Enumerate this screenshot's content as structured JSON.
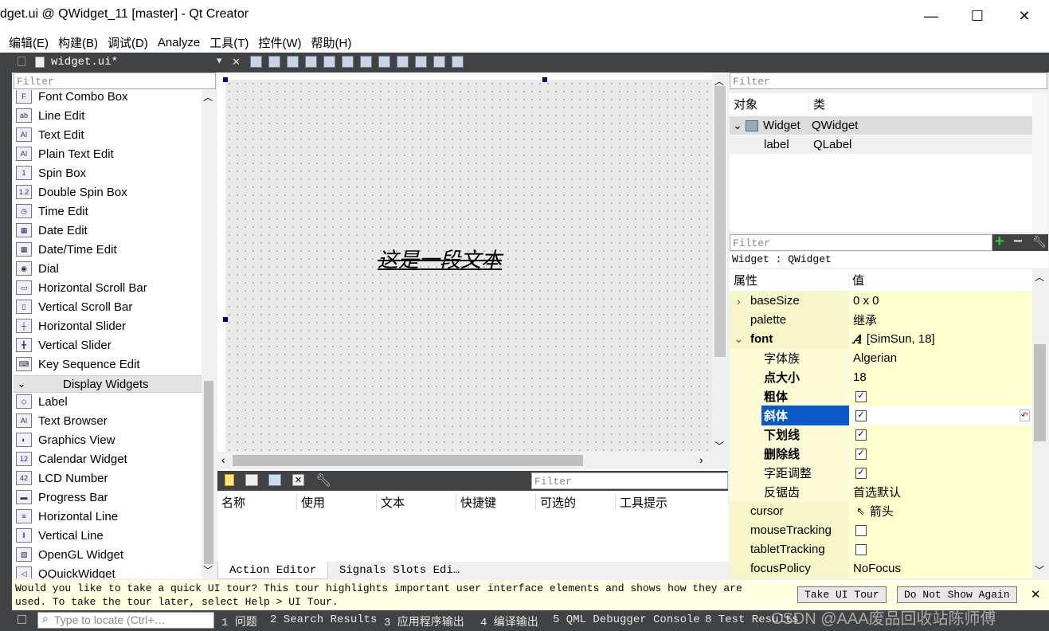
{
  "window": {
    "title": "dget.ui @ QWidget_11 [master] - Qt Creator",
    "minimize_glyph": "—",
    "maximize_glyph": "☐",
    "close_glyph": "✕"
  },
  "menu": [
    "编辑(E)",
    "构建(B)",
    "调试(D)",
    "Analyze",
    "工具(T)",
    "控件(W)",
    "帮助(H)"
  ],
  "editor_tab": {
    "file": "widget.ui*",
    "dropdown_glyph": "▾",
    "close_glyph": "✕"
  },
  "widget_box": {
    "filter_placeholder": "Filter",
    "items_top": [
      {
        "label": "Font Combo Box",
        "icon": "font-combo-icon",
        "glyph": "F"
      },
      {
        "label": "Line Edit",
        "icon": "line-edit-icon",
        "glyph": "ab"
      },
      {
        "label": "Text Edit",
        "icon": "text-edit-icon",
        "glyph": "AI"
      },
      {
        "label": "Plain Text Edit",
        "icon": "plain-text-edit-icon",
        "glyph": "AI"
      },
      {
        "label": "Spin Box",
        "icon": "spin-box-icon",
        "glyph": "1"
      },
      {
        "label": "Double Spin Box",
        "icon": "double-spin-box-icon",
        "glyph": "1.2"
      },
      {
        "label": "Time Edit",
        "icon": "clock-icon",
        "glyph": "◷"
      },
      {
        "label": "Date Edit",
        "icon": "calendar-icon",
        "glyph": "▦"
      },
      {
        "label": "Date/Time Edit",
        "icon": "calendar-clock-icon",
        "glyph": "▦"
      },
      {
        "label": "Dial",
        "icon": "dial-icon",
        "glyph": "◉"
      },
      {
        "label": "Horizontal Scroll Bar",
        "icon": "hscroll-icon",
        "glyph": "▭"
      },
      {
        "label": "Vertical Scroll Bar",
        "icon": "vscroll-icon",
        "glyph": "▯"
      },
      {
        "label": "Horizontal Slider",
        "icon": "hslider-icon",
        "glyph": "┼"
      },
      {
        "label": "Vertical Slider",
        "icon": "vslider-icon",
        "glyph": "╋"
      },
      {
        "label": "Key Sequence Edit",
        "icon": "key-sequence-icon",
        "glyph": "⌨"
      }
    ],
    "category": "Display Widgets",
    "category_glyph": "⌄",
    "items_display": [
      {
        "label": "Label",
        "icon": "label-tag-icon",
        "glyph": "◇"
      },
      {
        "label": "Text Browser",
        "icon": "text-browser-icon",
        "glyph": "AI"
      },
      {
        "label": "Graphics View",
        "icon": "graphics-view-icon",
        "glyph": "◐"
      },
      {
        "label": "Calendar Widget",
        "icon": "calendar-widget-icon",
        "glyph": "12"
      },
      {
        "label": "LCD Number",
        "icon": "lcd-icon",
        "glyph": "42"
      },
      {
        "label": "Progress Bar",
        "icon": "progress-icon",
        "glyph": "▬"
      },
      {
        "label": "Horizontal Line",
        "icon": "hline-icon",
        "glyph": "≡"
      },
      {
        "label": "Vertical Line",
        "icon": "vline-icon",
        "glyph": "‖"
      },
      {
        "label": "OpenGL Widget",
        "icon": "opengl-icon",
        "glyph": "▨"
      },
      {
        "label": "QQuickWidget",
        "icon": "quick-widget-icon",
        "glyph": "◁"
      }
    ]
  },
  "canvas": {
    "label_text": "这是一段文本"
  },
  "action_editor": {
    "filter_placeholder": "Filter",
    "columns": [
      "名称",
      "使用",
      "文本",
      "快捷键",
      "可选的",
      "工具提示"
    ],
    "tabs": [
      "Action Editor",
      "Signals  Slots Edi…"
    ]
  },
  "object_inspector": {
    "filter_placeholder": "Filter",
    "columns": [
      "对象",
      "类"
    ],
    "rows": [
      {
        "object": "Widget",
        "class": "QWidget"
      },
      {
        "object": "label",
        "class": "QLabel"
      }
    ]
  },
  "property_editor": {
    "filter_placeholder": "Filter",
    "context": "Widget : QWidget",
    "columns": [
      "属性",
      "值"
    ],
    "rows": [
      {
        "name": "baseSize",
        "value": "0 x 0",
        "expander": "›"
      },
      {
        "name": "palette",
        "value": "继承"
      },
      {
        "name": "font",
        "value": "[SimSun, 18]",
        "expander": "⌄",
        "bold": true
      },
      {
        "name": "字体族",
        "value": "Algerian",
        "sub": true
      },
      {
        "name": "点大小",
        "value": "18",
        "sub": true,
        "bold": true
      },
      {
        "name": "粗体",
        "checked": true,
        "sub": true,
        "bold": true
      },
      {
        "name": "斜体",
        "checked": true,
        "sub": true,
        "bold": true,
        "selected": true
      },
      {
        "name": "下划线",
        "checked": true,
        "sub": true,
        "bold": true
      },
      {
        "name": "删除线",
        "checked": true,
        "sub": true,
        "bold": true
      },
      {
        "name": "字距调整",
        "checked": true,
        "sub": true
      },
      {
        "name": "反锯齿",
        "value": "首选默认",
        "sub": true
      },
      {
        "name": "cursor",
        "value": "箭头"
      },
      {
        "name": "mouseTracking",
        "checked": false
      },
      {
        "name": "tabletTracking",
        "checked": false
      },
      {
        "name": "focusPolicy",
        "value": "NoFocus"
      }
    ]
  },
  "notification": {
    "message_line1": "Would you like to take a quick UI tour? This tour highlights important user interface elements and shows how they are",
    "message_line2": "used. To take the tour later, select Help > UI Tour.",
    "take_tour": "Take UI Tour",
    "dont_show": "Do Not Show Again",
    "close_glyph": "✕"
  },
  "status_bar": {
    "locate_placeholder": "Type to locate (Ctrl+…",
    "items": [
      "1 问题",
      "2 Search Results",
      "3 应用程序输出",
      "4 编译输出",
      "5 QML Debugger Console",
      "8 Test Results"
    ],
    "watermark": "CSDN @AAA废品回收站陈师傅"
  },
  "colors": {
    "dark_panel": "#404244",
    "selection": "#0a59c9",
    "property_yellow": "#ffffd0",
    "property_group": "#f6f6c8",
    "notification": "#ffffe1"
  }
}
